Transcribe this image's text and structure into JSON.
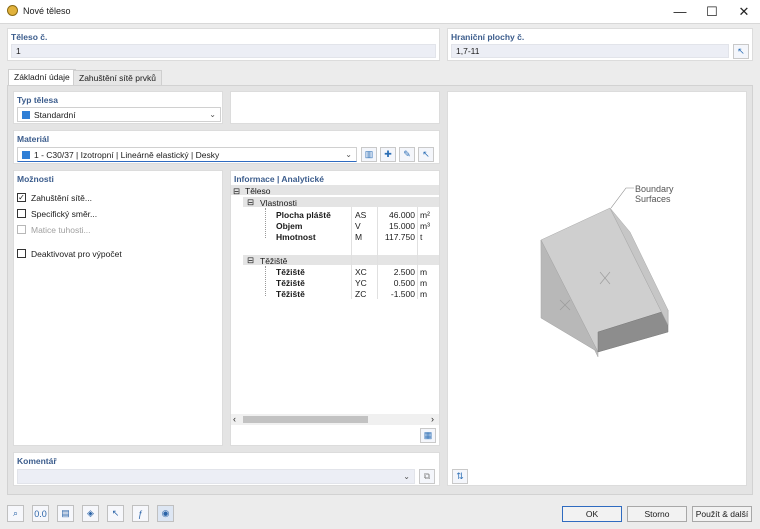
{
  "window": {
    "title": "Nové těleso",
    "minimize": "—",
    "maximize": "☐",
    "close": "✕"
  },
  "body_no": {
    "label": "Těleso č.",
    "value": "1"
  },
  "boundary": {
    "label": "Hraniční plochy č.",
    "value": "1,7-11"
  },
  "tabs": [
    {
      "label": "Základní údaje"
    },
    {
      "label": "Zahuštění sítě prvků"
    }
  ],
  "body_type": {
    "label": "Typ tělesa",
    "value": "Standardní",
    "color": "#2f7fd6"
  },
  "material": {
    "label": "Materiál",
    "value": "1 - C30/37 | Izotropní | Lineárně elastický | Desky",
    "color": "#2f7fd6"
  },
  "options": {
    "label": "Možnosti",
    "items": [
      {
        "label": "Zahuštění sítě...",
        "checked": true,
        "enabled": true
      },
      {
        "label": "Specifický směr...",
        "checked": false,
        "enabled": true
      },
      {
        "label": "Matice tuhosti...",
        "checked": false,
        "enabled": false
      },
      {
        "label": "Deaktivovat pro výpočet",
        "checked": false,
        "enabled": true
      }
    ]
  },
  "info": {
    "label": "Informace | Analytické",
    "root": "Těleso",
    "groups": [
      {
        "label": "Vlastnosti",
        "rows": [
          {
            "name": "Plocha pláště",
            "sym": "AS",
            "val": "46.000",
            "unit": "m²"
          },
          {
            "name": "Objem",
            "sym": "V",
            "val": "15.000",
            "unit": "m³"
          },
          {
            "name": "Hmotnost",
            "sym": "M",
            "val": "117.750",
            "unit": "t"
          }
        ]
      },
      {
        "label": "Těžiště",
        "rows": [
          {
            "name": "Těžiště",
            "sym": "XC",
            "val": "2.500",
            "unit": "m"
          },
          {
            "name": "Těžiště",
            "sym": "YC",
            "val": "0.500",
            "unit": "m"
          },
          {
            "name": "Těžiště",
            "sym": "ZC",
            "val": "-1.500",
            "unit": "m"
          }
        ]
      }
    ]
  },
  "preview": {
    "annotation_line1": "Boundary",
    "annotation_line2": "Surfaces"
  },
  "comment": {
    "label": "Komentář",
    "value": ""
  },
  "buttons": {
    "ok": "OK",
    "cancel": "Storno",
    "apply": "Použít & další"
  }
}
